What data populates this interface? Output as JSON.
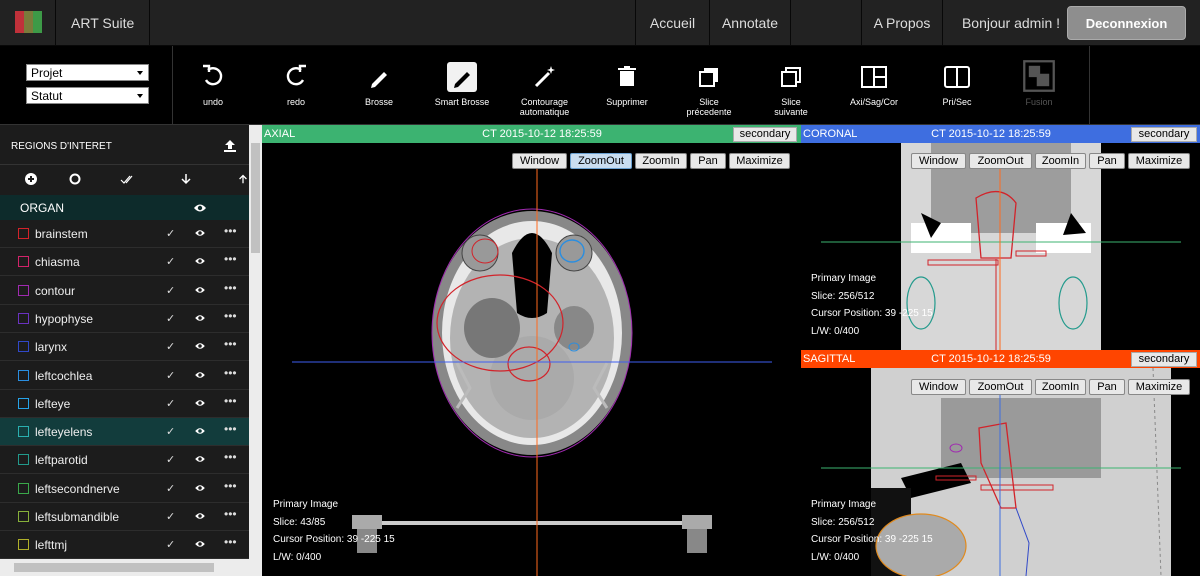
{
  "navbar": {
    "app_title": "ART Suite",
    "links": [
      "Accueil",
      "Annotate",
      "A Propos"
    ],
    "greeting": "Bonjour admin !",
    "logout": "Deconnexion",
    "logo_colors": [
      "#c0313a",
      "#7b7b3b",
      "#3d9a47"
    ]
  },
  "toolbar": {
    "selects": {
      "project": "Projet",
      "status": "Statut"
    },
    "tools": [
      {
        "label": "undo",
        "icon": "undo-icon"
      },
      {
        "label": "redo",
        "icon": "redo-icon"
      },
      {
        "label": "Brosse",
        "icon": "brush-icon"
      },
      {
        "label": "Smart Brosse",
        "icon": "smart-brush-icon"
      },
      {
        "label": "Contourage automatique",
        "icon": "magic-wand-icon"
      },
      {
        "label": "Supprimer",
        "icon": "trash-icon"
      },
      {
        "label": "Slice précedente",
        "icon": "slice-previous-icon"
      },
      {
        "label": "Slice suivante",
        "icon": "slice-next-icon"
      },
      {
        "label": "Axi/Sag/Cor",
        "icon": "layout-three-icon"
      },
      {
        "label": "Pri/Sec",
        "icon": "layout-two-icon"
      },
      {
        "label": "Fusion",
        "icon": "fusion-icon"
      }
    ]
  },
  "sidebar": {
    "title": "REGIONS D'INTERET",
    "column_header": "ORGAN",
    "organs": [
      {
        "name": "brainstem",
        "color": "#d2232a"
      },
      {
        "name": "chiasma",
        "color": "#d2236a"
      },
      {
        "name": "contour",
        "color": "#a02ab0"
      },
      {
        "name": "hypophyse",
        "color": "#6a32c0"
      },
      {
        "name": "larynx",
        "color": "#3048c8"
      },
      {
        "name": "leftcochlea",
        "color": "#2a8ee0"
      },
      {
        "name": "lefteye",
        "color": "#26a3e8"
      },
      {
        "name": "lefteyelens",
        "color": "#2ab0b0"
      },
      {
        "name": "leftparotid",
        "color": "#229a8c"
      },
      {
        "name": "leftsecondnerve",
        "color": "#3aa84a"
      },
      {
        "name": "leftsubmandible",
        "color": "#86b03a"
      },
      {
        "name": "lefttmj",
        "color": "#b0b02a"
      }
    ],
    "selected_index": 7
  },
  "viewers": {
    "axial": {
      "name": "AXIAL",
      "title": "CT 2015-10-12 18:25:59",
      "color": "#3cb371",
      "secondary": "secondary",
      "buttons": [
        "Window",
        "ZoomOut",
        "ZoomIn",
        "Pan",
        "Maximize"
      ],
      "active_button": "ZoomOut",
      "info": [
        "Primary Image",
        "Slice: 43/85",
        "Cursor Position: 39 -225 15",
        "L/W: 0/400"
      ]
    },
    "coronal": {
      "name": "CORONAL",
      "title": "CT 2015-10-12 18:25:59",
      "color": "#3e6ee0",
      "secondary": "secondary",
      "buttons": [
        "Window",
        "ZoomOut",
        "ZoomIn",
        "Pan",
        "Maximize"
      ],
      "info": [
        "Primary Image",
        "Slice: 256/512",
        "Cursor Position: 39 -225 15",
        "L/W: 0/400"
      ]
    },
    "sagittal": {
      "name": "SAGITTAL",
      "title": "CT 2015-10-12 18:25:59",
      "color": "#ff4500",
      "secondary": "secondary",
      "buttons": [
        "Window",
        "ZoomOut",
        "ZoomIn",
        "Pan",
        "Maximize"
      ],
      "info": [
        "Primary Image",
        "Slice: 256/512",
        "Cursor Position: 39 -225 15",
        "L/W: 0/400"
      ]
    }
  }
}
